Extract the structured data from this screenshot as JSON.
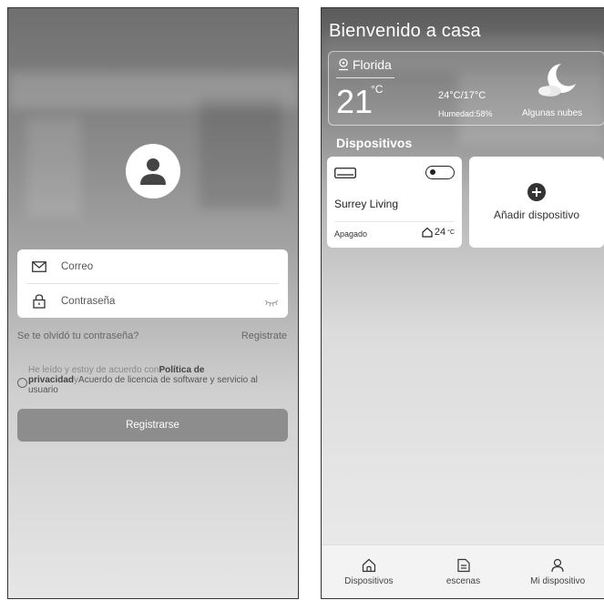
{
  "login": {
    "email_placeholder": "Correo",
    "password_placeholder": "Contraseña",
    "forgot_password": "Se te olvidó tu contraseña?",
    "register_link": "Registrate",
    "terms_prefix": "He leído y estoy de acuerdo con",
    "terms_privacy": "Política de privacidad",
    "terms_and": "y",
    "terms_license": "Acuerdo de licencia de software y servicio al usuario",
    "register_button": "Registrarse"
  },
  "home": {
    "welcome": "Bienvenido a casa",
    "weather": {
      "location": "Florida",
      "temperature": "21",
      "unit": "°C",
      "range": "24°C/17°C",
      "humidity": "Humedad:58%",
      "condition": "Algunas nubes",
      "icon": "moon-cloud-icon"
    },
    "devices_heading": "Dispositivos",
    "devices": [
      {
        "name": "Surrey Living",
        "status": "Apagado",
        "temp": "24",
        "temp_unit": "°C",
        "icon": "air-conditioner-icon"
      }
    ],
    "add_device": "Añadir dispositivo",
    "tabs": [
      {
        "label": "Dispositivos",
        "icon": "home-icon"
      },
      {
        "label": "escenas",
        "icon": "scenes-icon"
      },
      {
        "label": "Mi dispositivo",
        "icon": "user-icon"
      }
    ]
  }
}
